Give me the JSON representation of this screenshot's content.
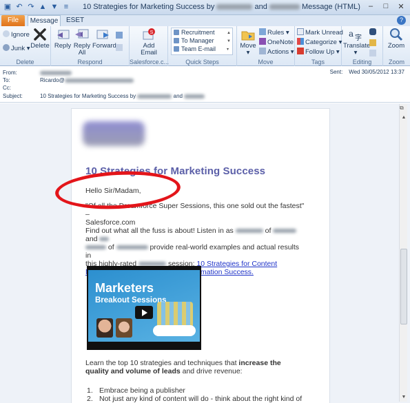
{
  "window": {
    "title_prefix": "10 Strategies for Marketing Success by",
    "title_mid": "and",
    "title_suffix": "Message (HTML)"
  },
  "tabs": {
    "file": "File",
    "message": "Message",
    "eset": "ESET"
  },
  "ribbon": {
    "delete": {
      "ignore": "Ignore",
      "junk": "Junk",
      "delete": "Delete",
      "label": "Delete"
    },
    "respond": {
      "reply": "Reply",
      "reply_all_1": "Reply",
      "reply_all_2": "All",
      "forward": "Forward",
      "label": "Respond"
    },
    "salesforce": {
      "add_1": "Add",
      "add_2": "Email",
      "label": "Salesforce.c..."
    },
    "quick_steps": {
      "items": [
        "Recruitment",
        "To Manager",
        "Team E-mail"
      ],
      "label": "Quick Steps"
    },
    "move": {
      "move": "Move",
      "rules": "Rules",
      "onenote": "OneNote",
      "actions": "Actions",
      "label": "Move"
    },
    "tags": {
      "mark_unread": "Mark Unread",
      "categorize": "Categorize",
      "follow_up": "Follow Up",
      "label": "Tags"
    },
    "editing": {
      "translate": "Translate",
      "label": "Editing"
    },
    "zoom": {
      "zoom": "Zoom",
      "label": "Zoom"
    }
  },
  "header": {
    "from_label": "From:",
    "to_label": "To:",
    "to_value": "Ricardo@",
    "cc_label": "Cc:",
    "subject_label": "Subject:",
    "subject_prefix": "10 Strategies for Marketing Success by",
    "subject_and": "and",
    "sent_label": "Sent:",
    "sent_value": "Wed 30/05/2012 13:37"
  },
  "email": {
    "heading": "10 Strategies for Marketing Success",
    "greeting": "Hello Sir/Madam,",
    "quote_1": "\"Of all the Dreamforce Super Sessions, this one sold out the fastest\" –",
    "quote_2": "Salesforce.com",
    "para_a": "Find out what all the fuss is about! Listen in as",
    "para_of": "of",
    "para_and": "and",
    "para_b": "provide real-world examples and actual results in",
    "para_c": "this highly-rated",
    "para_d": "session:",
    "link": "10 Strategies for Content Marketing, Events & Marketing Automation Success.",
    "video_title": "Marketers",
    "video_sub": "Breakout Sessions",
    "learn_1": "Learn the top 10 strategies and techniques that",
    "learn_bold": "increase the quality and volume of leads",
    "learn_2": "and drive revenue:",
    "list": [
      {
        "num": "1.",
        "text": "Embrace being a publisher"
      },
      {
        "num": "2.",
        "text": "Not just any kind of content will do - think about the right kind of"
      }
    ]
  },
  "colors": {
    "annotation_ellipse": "#e3151a",
    "heading": "#5b5fa8",
    "link": "#1f33c8",
    "file_tab": "#e0731a"
  }
}
